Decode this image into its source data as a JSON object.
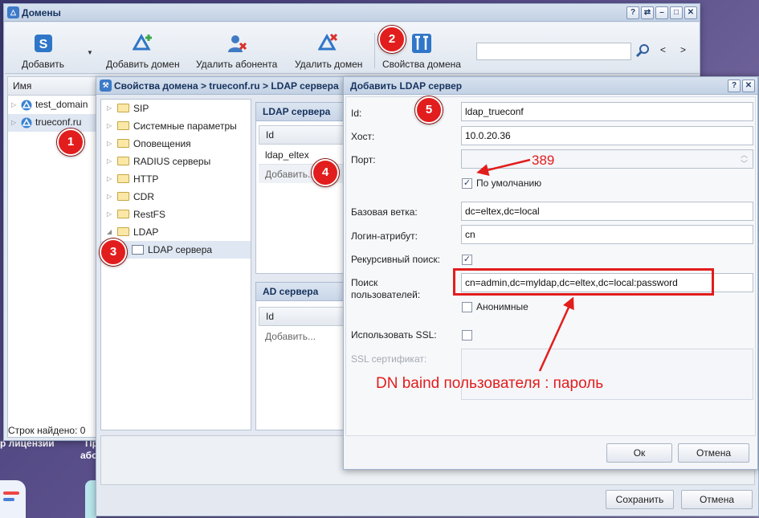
{
  "background": {
    "text_left": "р лицензий",
    "text_mid_1": "Пр",
    "text_mid_2": "або"
  },
  "domains_window": {
    "title": "Домены",
    "title_buttons": [
      "?",
      "⇄",
      "–",
      "□",
      "✕"
    ],
    "toolbar": {
      "add": "Добавить",
      "add_domain": "Добавить домен",
      "remove_subscriber": "Удалить абонента",
      "remove_domain": "Удалить домен",
      "domain_properties": "Свойства домена",
      "search_placeholder": "",
      "prev": "<",
      "next": ">"
    },
    "list": {
      "header": "Имя",
      "items": [
        "test_domain",
        "trueconf.ru"
      ],
      "status_prefix": "Строк найдено:",
      "status_value": "0"
    }
  },
  "properties_window": {
    "title": "Свойства домена > trueconf.ru > LDAP сервера",
    "tree": [
      "SIP",
      "Системные параметры",
      "Оповещения",
      "RADIUS серверы",
      "HTTP",
      "CDR",
      "RestFS",
      "LDAP",
      "LDAP сервера"
    ],
    "ldap_panel": {
      "title": "LDAP сервера",
      "col_id": "Id",
      "rows": [
        "ldap_eltex"
      ],
      "add": "Добавить..."
    },
    "ad_panel": {
      "title": "AD сервера",
      "col_id": "Id",
      "add": "Добавить..."
    },
    "save": "Сохранить",
    "cancel": "Отмена"
  },
  "add_ldap_dialog": {
    "title": "Добавить LDAP сервер",
    "title_buttons": [
      "?",
      "✕"
    ],
    "fields": {
      "id_label": "Id:",
      "id_value": "ldap_trueconf",
      "host_label": "Хост:",
      "host_value": "10.0.20.36",
      "port_label": "Порт:",
      "port_value": "",
      "default_label": "По умолчанию",
      "default_checked": "✓",
      "base_label": "Базовая ветка:",
      "base_value": "dc=eltex,dc=local",
      "login_label": "Логин-атрибут:",
      "login_value": "cn",
      "recursive_label": "Рекурсивный поиск:",
      "recursive_checked": "✓",
      "user_search_label_1": "Поиск",
      "user_search_label_2": "пользователей:",
      "user_search_value": "cn=admin,dc=myldap,dc=eltex,dc=local:password",
      "anonymous_label": "Анонимные",
      "anonymous_checked": "",
      "ssl_label": "Использовать SSL:",
      "ssl_checked": "",
      "ssl_cert_label": "SSL сертификат:"
    },
    "ok": "Ок",
    "cancel": "Отмена"
  },
  "annotations": {
    "markers": [
      "1",
      "2",
      "3",
      "4",
      "5"
    ],
    "port_note": "389",
    "dn_note": "DN baind пользователя : пароль",
    "color": "#e21d1d"
  }
}
